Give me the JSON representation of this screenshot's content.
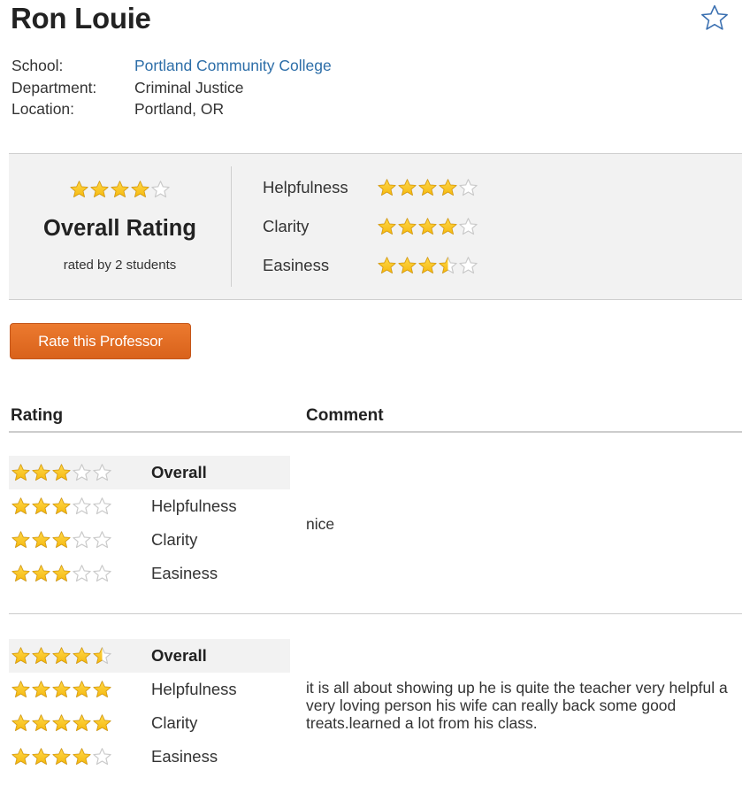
{
  "professor": {
    "name": "Ron Louie",
    "school_label": "School:",
    "school": "Portland Community College",
    "department_label": "Department:",
    "department": "Criminal Justice",
    "location_label": "Location:",
    "location": "Portland, OR"
  },
  "summary": {
    "overall_rating": 4,
    "overall_title": "Overall Rating",
    "rated_by": "rated by 2 students",
    "categories": [
      {
        "label": "Helpfulness",
        "rating": 4
      },
      {
        "label": "Clarity",
        "rating": 4
      },
      {
        "label": "Easiness",
        "rating": 3.5
      }
    ]
  },
  "rate_button": "Rate this Professor",
  "table": {
    "rating_header": "Rating",
    "comment_header": "Comment"
  },
  "reviews": [
    {
      "ratings": [
        {
          "label": "Overall",
          "rating": 3
        },
        {
          "label": "Helpfulness",
          "rating": 3
        },
        {
          "label": "Clarity",
          "rating": 3
        },
        {
          "label": "Easiness",
          "rating": 3
        }
      ],
      "comment": "nice"
    },
    {
      "ratings": [
        {
          "label": "Overall",
          "rating": 4.5
        },
        {
          "label": "Helpfulness",
          "rating": 5
        },
        {
          "label": "Clarity",
          "rating": 5
        },
        {
          "label": "Easiness",
          "rating": 4
        }
      ],
      "comment": "it is all about showing up he is quite the teacher very helpful a very loving person his wife can really back some good treats.learned a lot from his class."
    }
  ],
  "colors": {
    "star_fill": "#f5b90f",
    "star_empty": "#c9c9c9",
    "link": "#2d6ea8",
    "button": "#e06d22"
  },
  "icons": {
    "favorite": "star-outline-icon",
    "rating": "star-icon"
  }
}
